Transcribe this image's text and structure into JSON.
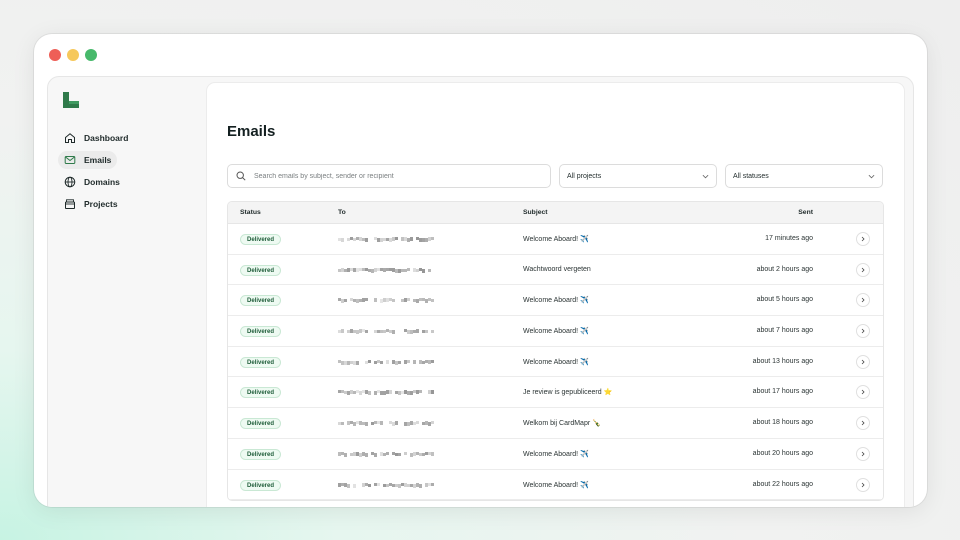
{
  "colors": {
    "accent": "#2f7a4a",
    "badge_bg": "#eefaf2",
    "badge_text": "#1d5c38"
  },
  "nav": [
    {
      "label": "Dashboard",
      "icon": "home-icon"
    },
    {
      "label": "Emails",
      "icon": "mail-icon",
      "active": true
    },
    {
      "label": "Domains",
      "icon": "globe-icon"
    },
    {
      "label": "Projects",
      "icon": "box-icon"
    }
  ],
  "page": {
    "title": "Emails"
  },
  "search": {
    "placeholder": "Search emails by subject, sender or recipient"
  },
  "filters": {
    "projects": "All projects",
    "statuses": "All statuses"
  },
  "table": {
    "headers": {
      "status": "Status",
      "to": "To",
      "subject": "Subject",
      "sent": "Sent"
    },
    "rows": [
      {
        "status": "Delivered",
        "subject": "Welcome Aboard! ✈️",
        "sent": "17 minutes ago"
      },
      {
        "status": "Delivered",
        "subject": "Wachtwoord vergeten",
        "sent": "about 2 hours ago"
      },
      {
        "status": "Delivered",
        "subject": "Welcome Aboard! ✈️",
        "sent": "about 5 hours ago"
      },
      {
        "status": "Delivered",
        "subject": "Welcome Aboard! ✈️",
        "sent": "about 7 hours ago"
      },
      {
        "status": "Delivered",
        "subject": "Welcome Aboard! ✈️",
        "sent": "about 13 hours ago"
      },
      {
        "status": "Delivered",
        "subject": "Je review is gepubliceerd ⭐",
        "sent": "about 17 hours ago"
      },
      {
        "status": "Delivered",
        "subject": "Welkom bij CardMapr 🍾",
        "sent": "about 18 hours ago"
      },
      {
        "status": "Delivered",
        "subject": "Welcome Aboard! ✈️",
        "sent": "about 20 hours ago"
      },
      {
        "status": "Delivered",
        "subject": "Welcome Aboard! ✈️",
        "sent": "about 22 hours ago"
      }
    ]
  }
}
